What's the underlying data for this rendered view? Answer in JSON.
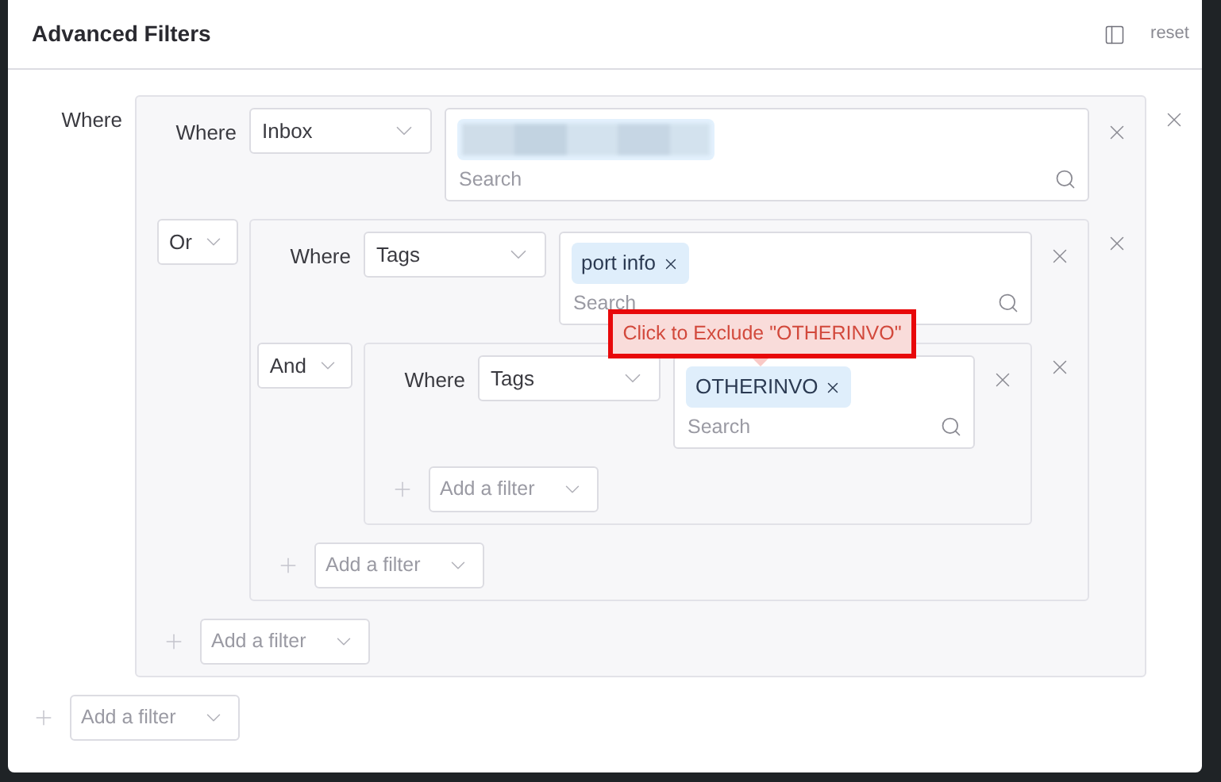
{
  "dialog": {
    "title": "Advanced Filters",
    "reset": "reset"
  },
  "tooltip": {
    "text": "Click to Exclude \"OTHERINVO\""
  },
  "filters": {
    "rows": [
      {
        "connector": {
          "kind": "label",
          "text": "Where"
        },
        "item": {
          "kind": "group",
          "rows": [
            {
              "connector": {
                "kind": "label",
                "text": "Where"
              },
              "item": {
                "kind": "condition",
                "field": "Inbox",
                "tags": [
                  {
                    "kind": "redacted"
                  }
                ],
                "placeholder": "Search"
              }
            },
            {
              "connector": {
                "kind": "select",
                "text": "Or"
              },
              "item": {
                "kind": "group",
                "rows": [
                  {
                    "connector": {
                      "kind": "label",
                      "text": "Where"
                    },
                    "item": {
                      "kind": "condition",
                      "field": "Tags",
                      "tags": [
                        {
                          "kind": "tag",
                          "text": "port info"
                        }
                      ],
                      "placeholder": "Search"
                    }
                  },
                  {
                    "connector": {
                      "kind": "select",
                      "text": "And"
                    },
                    "item": {
                      "kind": "group",
                      "rows": [
                        {
                          "connector": {
                            "kind": "label",
                            "text": "Where"
                          },
                          "item": {
                            "kind": "condition",
                            "field": "Tags",
                            "tags": [
                              {
                                "kind": "tag",
                                "text": "OTHERINVO"
                              }
                            ],
                            "placeholder": "Search"
                          }
                        }
                      ],
                      "add_filter": "Add a filter"
                    }
                  }
                ],
                "add_filter": "Add a filter"
              }
            }
          ],
          "add_filter": "Add a filter"
        }
      }
    ],
    "add_filter": "Add a filter"
  }
}
